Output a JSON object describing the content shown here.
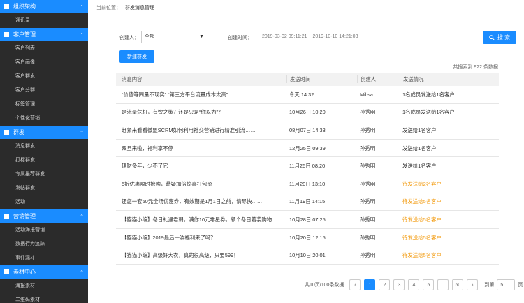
{
  "sidebar": {
    "sections": [
      {
        "title": "组织架构",
        "items": [
          "通讯录"
        ]
      },
      {
        "title": "客户管理",
        "items": [
          "客户列表",
          "客户画像",
          "客户群发",
          "客户分群",
          "标签管理",
          "个性化营销"
        ]
      },
      {
        "title": "群发",
        "items": [
          "消息群发",
          "打标群发",
          "专属推荐群发",
          "发帖群发",
          "活动"
        ]
      },
      {
        "title": "营销管理",
        "items": [
          "活动海报营销",
          "数据行为追踪",
          "事件漏斗"
        ]
      },
      {
        "title": "素材中心",
        "items": [
          "海报素材",
          "二维码素材"
        ]
      }
    ]
  },
  "breadcrumb": {
    "label": "当前位置：",
    "current": "群发消息管理"
  },
  "filters": {
    "creator_label": "创建人：",
    "creator_value": "全部",
    "date_label": "创建时间：",
    "date_value": "2019-03-02 09:11:21 ~ 2019-10-10 14:21:03"
  },
  "search_button": "搜 索",
  "new_button": "新建群发",
  "total_text": "共搜索到 922 条数据",
  "table": {
    "headers": [
      "消息内容",
      "发送时间",
      "创建人",
      "发送情况"
    ],
    "rows": [
      {
        "content": "“价值等同量不现实” “第三方平台流量成本太高”……",
        "time": "今天 14:32",
        "creator": "Milisa",
        "status": "1名成员发送给1名客户",
        "pending": false
      },
      {
        "content": "是流量危机，有饮之策？还是只是“你以为”？",
        "time": "10月26日 10:20",
        "creator": "孙秀明",
        "status": "1名成员发送给1名客户",
        "pending": false
      },
      {
        "content": "赶紧来看看微盟SCRM如何利用社交营销进行精准引流……",
        "time": "08月07日 14:33",
        "creator": "孙秀明",
        "status": "发送给1名客户",
        "pending": false
      },
      {
        "content": "双旦来啦，福利享不停",
        "time": "12月25日 09:39",
        "creator": "孙秀明",
        "status": "发送给1名客户",
        "pending": false
      },
      {
        "content": "理财多年，少不了它",
        "time": "11月25日 08:20",
        "creator": "孙秀明",
        "status": "发送给1名客户",
        "pending": false
      },
      {
        "content": "5折优惠限时抢购，悬疑加倍惊喜打包价",
        "time": "11月20日 13:10",
        "creator": "孙秀明",
        "status": "待发送给2名客户",
        "pending": true
      },
      {
        "content": "还您一套50元全场优惠券，有效期是1月1日之前，请尽快……",
        "time": "11月19日 14:15",
        "creator": "孙秀明",
        "status": "待发送给5名客户",
        "pending": true
      },
      {
        "content": "【猫猫小编】冬日礼遇君弱，满你10元零星券，领个冬日着装购物……",
        "time": "10月28日 07:25",
        "creator": "孙秀明",
        "status": "待发送给5名客户",
        "pending": true
      },
      {
        "content": "【猫猫小编】2019最后一波福利来了吗？",
        "time": "10月20日 12:15",
        "creator": "孙秀明",
        "status": "待发送给5名客户",
        "pending": true
      },
      {
        "content": "【猫猫小编】高级好大衣，真的很高级，只要599！",
        "time": "10月10日 20:01",
        "creator": "孙秀明",
        "status": "待发送给5名客户",
        "pending": true
      }
    ]
  },
  "pagination": {
    "info": "共10页/100条数据",
    "prev": "‹",
    "pages": [
      "1",
      "2",
      "3",
      "4",
      "5",
      "…",
      "50"
    ],
    "next": "›",
    "goto_label": "到第",
    "goto_value": "5",
    "page_unit": "页"
  },
  "colors": {
    "accent": "#1a8cff",
    "pending": "#f39c12",
    "sidebar": "#2b2b2b"
  }
}
